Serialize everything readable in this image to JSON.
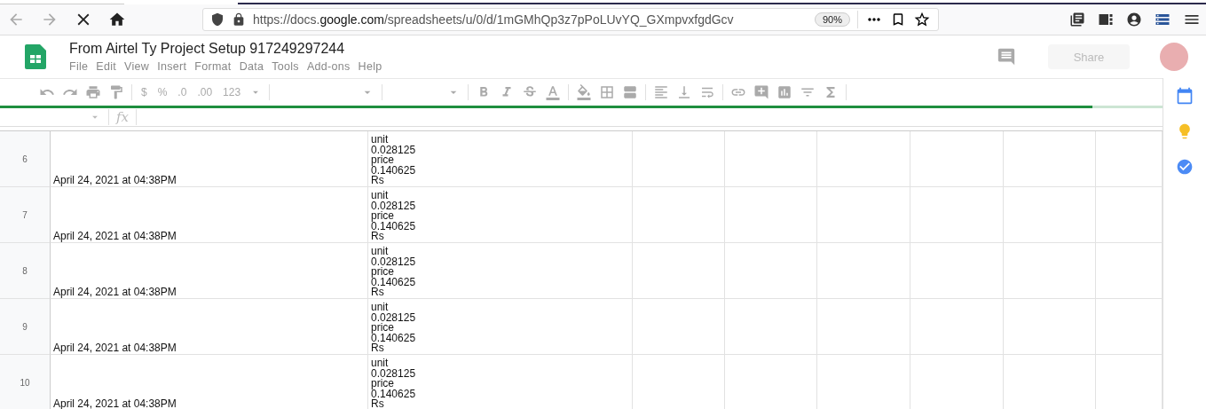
{
  "browser": {
    "url": "https://docs.**google.com**/spreadsheets/u/0/d/1mGMhQp3z7pPoLUvYQ_GXmpvxfgdGcv",
    "zoom": "90%"
  },
  "document": {
    "title": "From Airtel Ty Project Setup 917249297244",
    "menu": [
      "File",
      "Edit",
      "View",
      "Insert",
      "Format",
      "Data",
      "Tools",
      "Add-ons",
      "Help"
    ],
    "share": "Share"
  },
  "toolbar": {
    "format_buttons": [
      "$",
      "%",
      ".0",
      ".00",
      "123"
    ],
    "loading": {
      "level": 0.94
    }
  },
  "formula_bar": {
    "function_label": "fx"
  },
  "rows": [
    {
      "number": "6",
      "column_a": "April 24, 2021 at 04:38PM",
      "column_b": "unit\n0.028125\nprice\n0.140625\nRs"
    },
    {
      "number": "7",
      "column_a": "April 24, 2021 at 04:38PM",
      "column_b": "unit\n0.028125\nprice\n0.140625\nRs"
    },
    {
      "number": "8",
      "column_a": "April 24, 2021 at 04:38PM",
      "column_b": "unit\n0.028125\nprice\n0.140625\nRs"
    },
    {
      "number": "9",
      "column_a": "April 24, 2021 at 04:38PM",
      "column_b": "unit\n0.028125\nprice\n0.140625\nRs"
    },
    {
      "number": "10",
      "column_a": "April 24, 2021 at 04:38PM",
      "column_b": "unit\n0.028125\nprice\n0.140625\nRs"
    }
  ]
}
